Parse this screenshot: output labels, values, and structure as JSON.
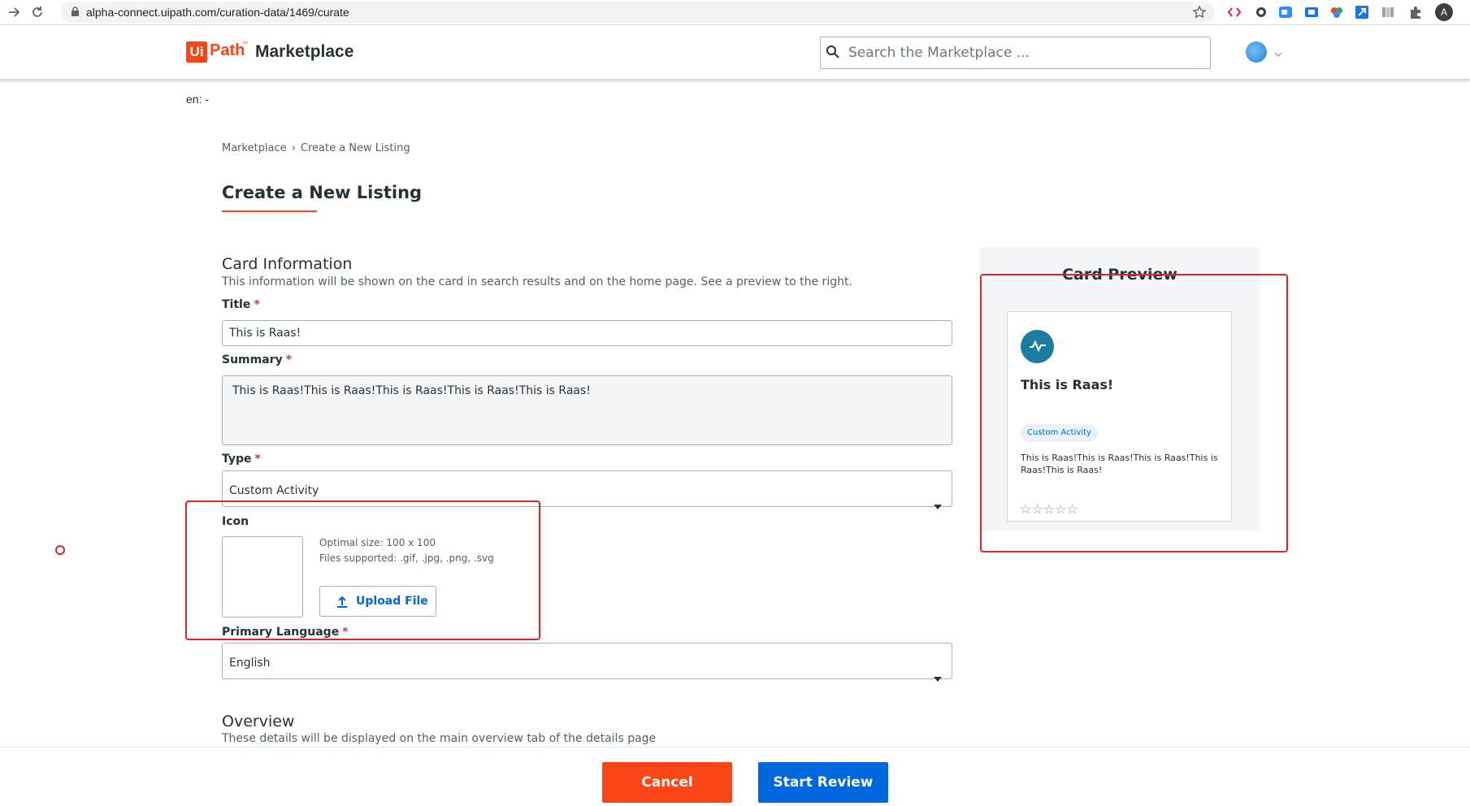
{
  "browser": {
    "url": "alpha-connect.uipath.com/curation-data/1469/curate",
    "profile_initial": "A"
  },
  "header": {
    "logo_ui": "Ui",
    "logo_path": "Path",
    "logo_tm": "™",
    "logo_marketplace": "Marketplace",
    "search_placeholder": "Search the Marketplace ..."
  },
  "language_indicator": "en: -",
  "breadcrumb": {
    "items": [
      "Marketplace",
      "Create a New Listing"
    ],
    "separator": "›"
  },
  "page_title": "Create a New Listing",
  "card_information": {
    "title": "Card Information",
    "description": "This information will be shown on the card in search results and on the home page. See a preview to the right.",
    "title_label": "Title",
    "title_value": "This is Raas!",
    "summary_label": "Summary",
    "summary_value": "This is Raas!This is Raas!This is Raas!This is Raas!This is Raas!",
    "type_label": "Type",
    "type_value": "Custom Activity",
    "icon_label": "Icon",
    "icon_hint_size": "Optimal size: 100 x 100",
    "icon_hint_files": "Files supported: .gif, .jpg, .png, .svg",
    "upload_label": "Upload File",
    "primary_language_label": "Primary Language",
    "primary_language_value": "English",
    "required_mark": "*"
  },
  "overview": {
    "title": "Overview",
    "description": "These details will be displayed on the main overview tab of the details page"
  },
  "card_preview": {
    "heading": "Card Preview",
    "title": "This is Raas!",
    "badge": "Custom Activity",
    "summary": "This is Raas!This is Raas!This is Raas!This is Raas!This is Raas!",
    "rating_stars": "☆☆☆☆☆",
    "rating": 0
  },
  "footer": {
    "cancel_label": "Cancel",
    "start_review_label": "Start Review"
  },
  "colors": {
    "brand_orange": "#fa4616",
    "primary_blue": "#0067df",
    "required_red": "#cc3d45",
    "annotation_red": "#e0232e"
  }
}
